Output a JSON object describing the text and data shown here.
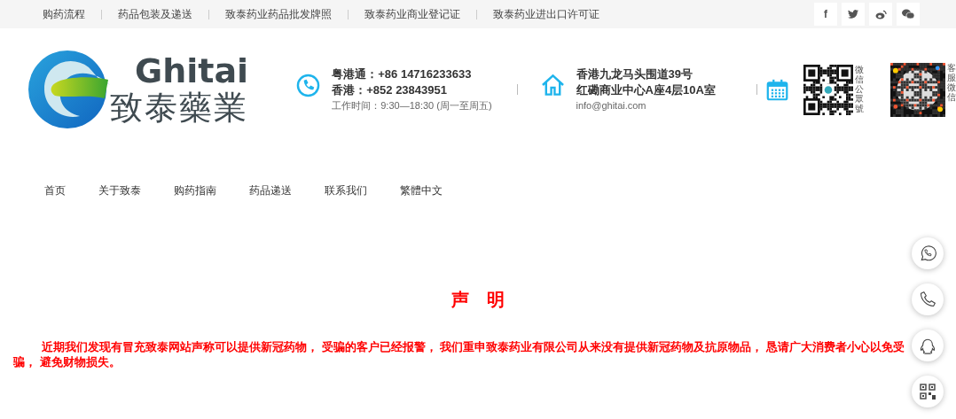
{
  "top_links": [
    "购药流程",
    "药品包装及递送",
    "致泰药业药品批发牌照",
    "致泰药业商业登记证",
    "致泰药业进出口许可证"
  ],
  "social": [
    {
      "kind": "facebook",
      "glyph": "f"
    },
    {
      "kind": "twitter"
    },
    {
      "kind": "weibo"
    },
    {
      "kind": "wechat"
    }
  ],
  "logo": {
    "name": "Ghitai",
    "subtitle": "致泰藥業"
  },
  "contact": {
    "lines": [
      "粤港通：+86 14716233633",
      "香港：+852 23843951"
    ],
    "hours": "工作时间：9:30—18:30 (周一至周五)"
  },
  "address": {
    "lines": [
      "香港九龙马头围道39号",
      "红磡商业中心A座4层10A室"
    ],
    "email": "info@ghitai.com"
  },
  "qr_codes": [
    {
      "label": "微信公眾號"
    },
    {
      "label": "客服微信"
    }
  ],
  "nav": [
    {
      "label": "首页"
    },
    {
      "label": "关于致泰"
    },
    {
      "label": "购药指南"
    },
    {
      "label": "药品递送"
    },
    {
      "label": "联系我们"
    },
    {
      "label": "繁體中文"
    }
  ],
  "notice": {
    "title": "声　明",
    "text": "近期我们发现有冒充致泰网站声称可以提供新冠药物， 受骗的客户已经报警， 我们重申致泰药业有限公司从来没有提供新冠药物及抗原物品， 恳请广大消费者小心以免受骗， 避免财物损失。"
  },
  "float_buttons": [
    {
      "kind": "whatsapp"
    },
    {
      "kind": "phone"
    },
    {
      "kind": "qq"
    },
    {
      "kind": "qr"
    }
  ]
}
